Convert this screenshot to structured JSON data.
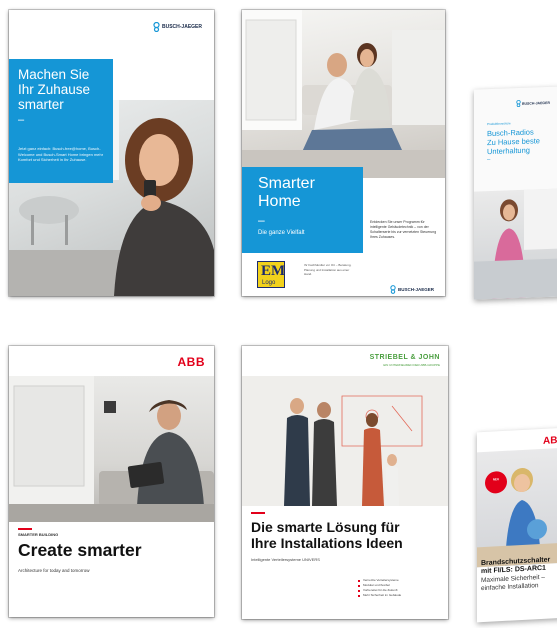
{
  "brochure1": {
    "logo": "BUSCH-JAEGER",
    "headline": [
      "Machen Sie",
      "Ihr Zuhause",
      "smarter"
    ],
    "dash": "–",
    "blurb": "Jetzt ganz einfach: Busch-free@home, Busch-Welcome und Busch-Smart Home bringen mehr Komfort und Sicherheit in Ihr Zuhause."
  },
  "brochure2": {
    "headline": [
      "Smarter",
      "Home"
    ],
    "dash": "–",
    "subtitle": "Die ganze Vielfalt",
    "description": "Entdecken Sie unser Programm für intelligente Gebäudetechnik – von der Schalterserie bis zur vernetzten Steuerung Ihres Zuhauses.",
    "dealer_logo_top": "EM",
    "dealer_logo_bottom": "Logo",
    "contact": "Ihr Fachhändler vor Ort – Beratung, Planung und Installation aus einer Hand.",
    "logo": "BUSCH-JAEGER"
  },
  "brochure3": {
    "logo": "BUSCH-JAEGER",
    "category": "Produktbroschüre",
    "title": [
      "Busch-Radios",
      "Zu Hause beste",
      "Unterhaltung"
    ],
    "dash": "–"
  },
  "brochure4": {
    "logo": "ABB",
    "category": "SMARTER BUILDING",
    "title": "Create smarter",
    "subtitle": "Architecture for today and tomorrow"
  },
  "brochure5": {
    "logo": "STRIEBEL & JOHN",
    "tagline": "EIN UNTERNEHMEN DER ABB-GRUPPE",
    "title": [
      "Die smarte Lösung für",
      "Ihre Installations Ideen"
    ],
    "subtitle": "Intelligente Verteilersysteme UNIVERS",
    "bullets": [
      "Vernetzte Verteilersysteme",
      "Modular und flexibel",
      "Vorbereitet für die Zukunft",
      "Mehr Sicherheit im Gebäude"
    ]
  },
  "brochure6": {
    "logo": "ABB",
    "badge": "NEU",
    "title": [
      "Brandschutzschalter",
      "mit FI/LS: DS-ARC1"
    ],
    "subtitle": [
      "Maximale Sicherheit –",
      "einfache Installation"
    ]
  },
  "colors": {
    "busch_blue": "#1596d6",
    "abb_red": "#e2001a",
    "sj_green": "#4a9e3f"
  }
}
